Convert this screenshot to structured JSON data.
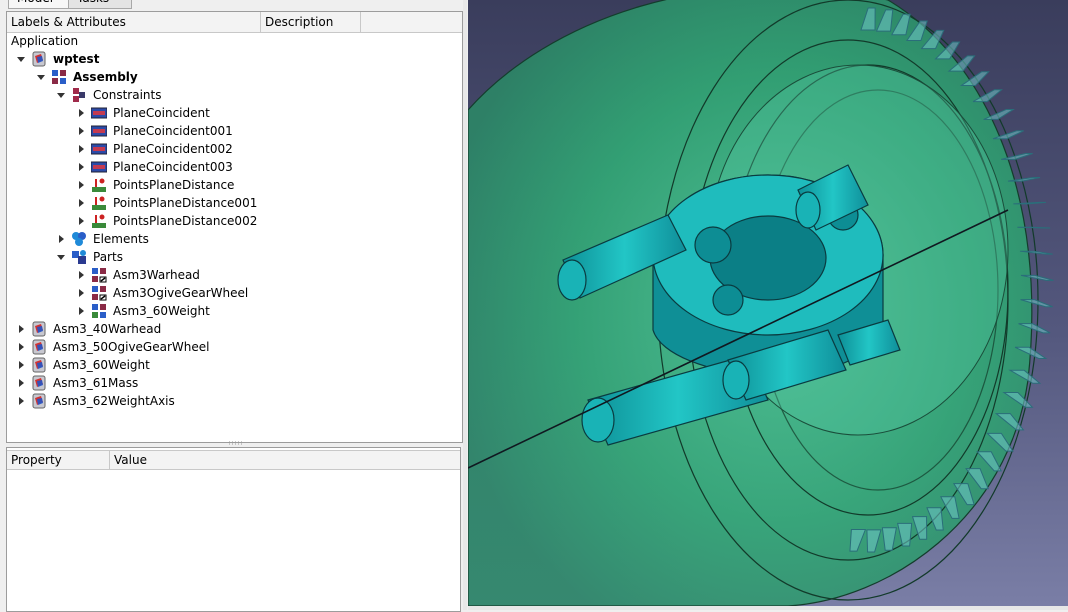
{
  "tabs": {
    "model": "Model",
    "tasks": "Tasks"
  },
  "tree": {
    "headers": {
      "labels": "Labels & Attributes",
      "description": "Description"
    },
    "root_label": "Application",
    "rows": [
      {
        "label": "wptest",
        "depth": 0,
        "expander": "down",
        "bold": true,
        "icon": "document-icon"
      },
      {
        "label": "Assembly",
        "depth": 1,
        "expander": "down",
        "bold": true,
        "icon": "assembly-icon"
      },
      {
        "label": "Constraints",
        "depth": 2,
        "expander": "down",
        "bold": false,
        "icon": "constraints-group-icon"
      },
      {
        "label": "PlaneCoincident",
        "depth": 3,
        "expander": "right",
        "bold": false,
        "icon": "plane-coincident-icon"
      },
      {
        "label": "PlaneCoincident001",
        "depth": 3,
        "expander": "right",
        "bold": false,
        "icon": "plane-coincident-icon"
      },
      {
        "label": "PlaneCoincident002",
        "depth": 3,
        "expander": "right",
        "bold": false,
        "icon": "plane-coincident-icon"
      },
      {
        "label": "PlaneCoincident003",
        "depth": 3,
        "expander": "right",
        "bold": false,
        "icon": "plane-coincident-icon"
      },
      {
        "label": "PointsPlaneDistance",
        "depth": 3,
        "expander": "right",
        "bold": false,
        "icon": "points-plane-distance-icon"
      },
      {
        "label": "PointsPlaneDistance001",
        "depth": 3,
        "expander": "right",
        "bold": false,
        "icon": "points-plane-distance-icon"
      },
      {
        "label": "PointsPlaneDistance002",
        "depth": 3,
        "expander": "right",
        "bold": false,
        "icon": "points-plane-distance-icon"
      },
      {
        "label": "Elements",
        "depth": 2,
        "expander": "right",
        "bold": false,
        "icon": "elements-group-icon"
      },
      {
        "label": "Parts",
        "depth": 2,
        "expander": "down",
        "bold": false,
        "icon": "parts-group-icon"
      },
      {
        "label": "Asm3Warhead",
        "depth": 3,
        "expander": "right",
        "bold": false,
        "icon": "linked-assembly-icon"
      },
      {
        "label": "Asm3OgiveGearWheel",
        "depth": 3,
        "expander": "right",
        "bold": false,
        "icon": "linked-assembly-icon"
      },
      {
        "label": "Asm3_60Weight",
        "depth": 3,
        "expander": "right",
        "bold": false,
        "icon": "assembly-part-icon"
      },
      {
        "label": "Asm3_40Warhead",
        "depth": 0,
        "expander": "right",
        "bold": false,
        "icon": "document-icon"
      },
      {
        "label": "Asm3_50OgiveGearWheel",
        "depth": 0,
        "expander": "right",
        "bold": false,
        "icon": "document-icon"
      },
      {
        "label": "Asm3_60Weight",
        "depth": 0,
        "expander": "right",
        "bold": false,
        "icon": "document-icon"
      },
      {
        "label": "Asm3_61Mass",
        "depth": 0,
        "expander": "right",
        "bold": false,
        "icon": "document-icon"
      },
      {
        "label": "Asm3_62WeightAxis",
        "depth": 0,
        "expander": "right",
        "bold": false,
        "icon": "document-icon"
      }
    ]
  },
  "property": {
    "headers": {
      "property": "Property",
      "value": "Value"
    }
  },
  "viewport": {
    "colors": {
      "background_top": "#3a3d5c",
      "background_bottom": "#7a7ea6",
      "shell": "#37b77a",
      "core": "#1aa3a8",
      "edge": "#0c2a22"
    }
  }
}
